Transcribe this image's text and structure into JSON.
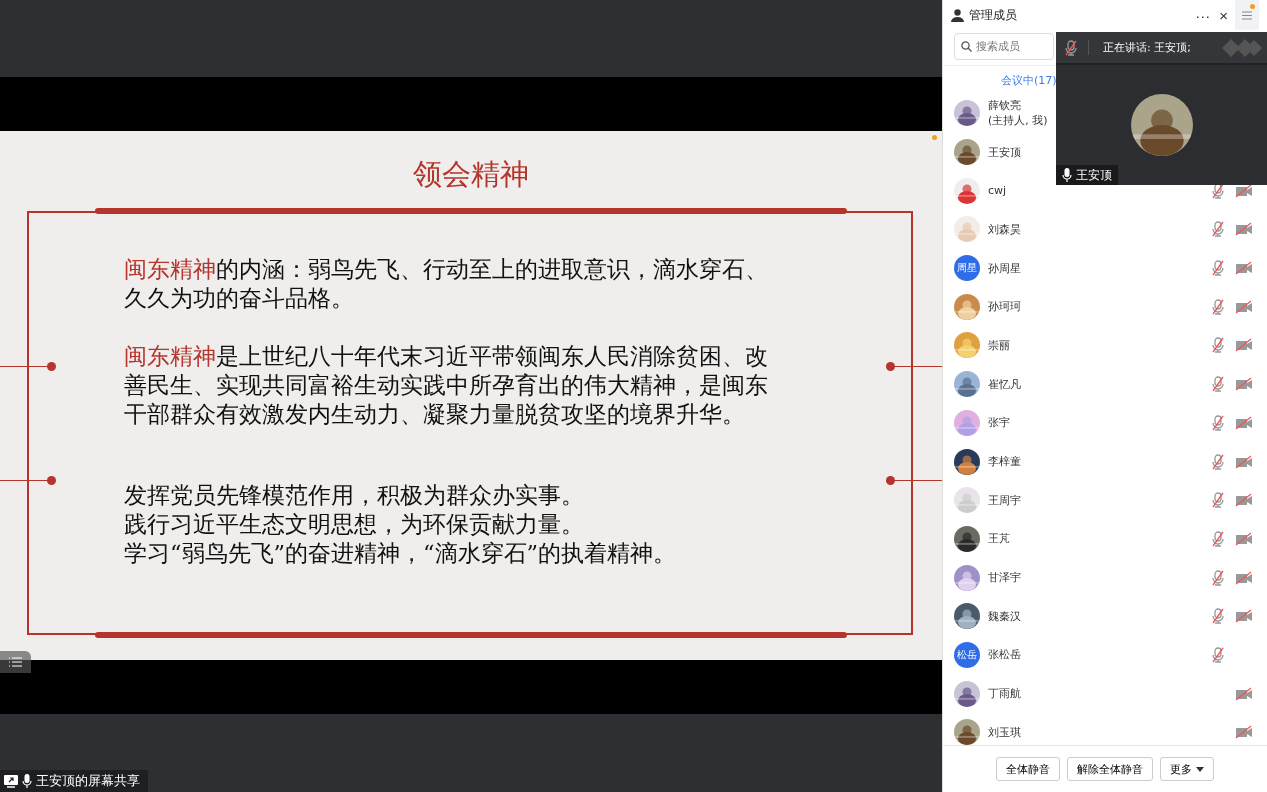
{
  "slide": {
    "title": "领会精神",
    "paragraphs": [
      "**闽东精神**的内涵：弱鸟先飞、行动至上的进取意识，滴水穿石、久久为功的奋斗品格。",
      "**闽东精神**是上世纪八十年代末习近平带领闽东人民消除贫困、改善民生、实现共同富裕生动实践中所孕育出的伟大精神，是闽东干部群众有效激发内生动力、凝聚力量脱贫攻坚的境界升华。"
    ],
    "lines": [
      "发挥党员先锋模范作用，积极为群众办实事。",
      "践行习近平生态文明思想，为环保贡献力量。",
      "学习“弱鸟先飞”的奋进精神，“滴水穿石”的执着精神。"
    ]
  },
  "share_label": "王安顶的屏幕共享",
  "panel": {
    "title": "管理成员",
    "more": "···",
    "close": "×",
    "search": {
      "placeholder": "搜索成员"
    },
    "tab": "会议中(17)",
    "members": [
      {
        "name": "薛钦亮",
        "note": "(主持人, 我)",
        "kind": "picture"
      },
      {
        "name": "王安顶",
        "kind": "picture"
      },
      {
        "name": "cwj",
        "kind": "picture",
        "mic_muted": true,
        "video_off": true
      },
      {
        "name": "刘森昊",
        "kind": "picture",
        "mic_muted": true,
        "video_off": true
      },
      {
        "name": "孙周星",
        "kind": "text",
        "initials": "周星",
        "mic_muted": true,
        "video_off": true
      },
      {
        "name": "孙珂珂",
        "kind": "picture",
        "mic_muted": true,
        "video_off": true
      },
      {
        "name": "崇丽",
        "kind": "picture",
        "mic_muted": true,
        "video_off": true
      },
      {
        "name": "崔忆凡",
        "kind": "picture",
        "mic_muted": true,
        "video_off": true
      },
      {
        "name": "张宇",
        "kind": "picture",
        "mic_muted": true,
        "video_off": true
      },
      {
        "name": "李梓童",
        "kind": "picture",
        "mic_muted": true,
        "video_off": true
      },
      {
        "name": "王周宇",
        "kind": "picture",
        "mic_muted": true,
        "video_off": true
      },
      {
        "name": "王芃",
        "kind": "picture",
        "mic_muted": true,
        "video_off": true
      },
      {
        "name": "甘泽宇",
        "kind": "picture",
        "mic_muted": true,
        "video_off": true
      },
      {
        "name": "魏秦汉",
        "kind": "picture",
        "mic_muted": true,
        "video_off": true
      },
      {
        "name": "张松岳",
        "kind": "text",
        "initials": "松岳",
        "mic_muted": true,
        "video_off": false
      },
      {
        "name": "丁雨航",
        "kind": "picture",
        "mic_muted": false,
        "video_off": true
      },
      {
        "name": "刘玉琪",
        "kind": "picture",
        "mic_muted": false,
        "video_off": true
      }
    ],
    "buttons": [
      "全体静音",
      "解除全体静音",
      "更多"
    ]
  },
  "speaker": {
    "label": "正在讲话: 王安顶;",
    "name": "王安顶"
  }
}
